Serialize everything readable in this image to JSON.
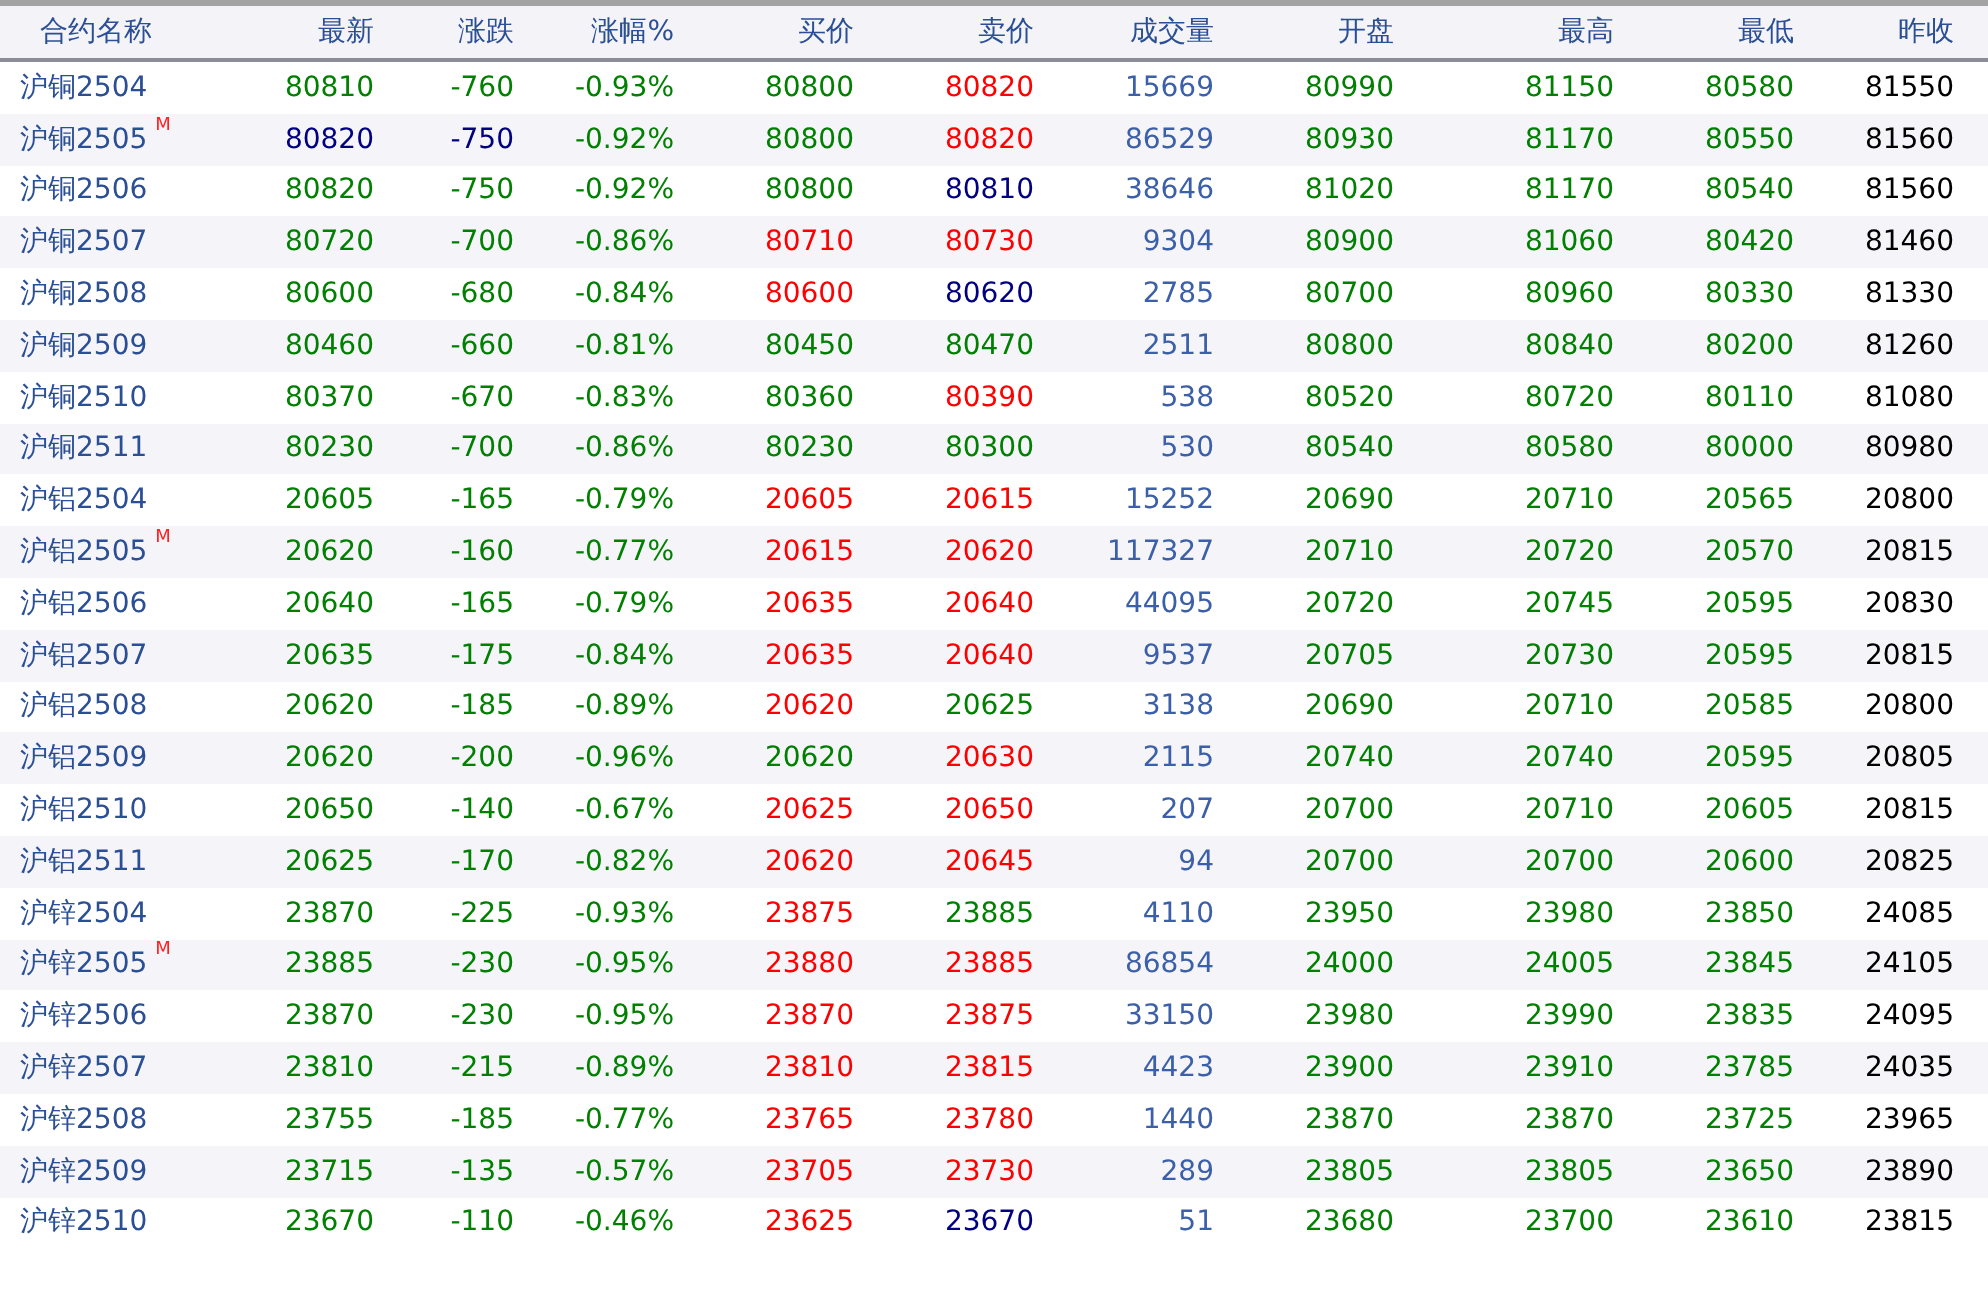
{
  "columns": [
    "合约名称",
    "最新",
    "涨跌",
    "涨幅%",
    "买价",
    "卖价",
    "成交量",
    "开盘",
    "最高",
    "最低",
    "昨收"
  ],
  "rows": [
    {
      "name": "沪铜2504",
      "cells": [
        {
          "text": "80810",
          "color": "#008000"
        },
        {
          "text": "-760",
          "color": "#008000"
        },
        {
          "text": "-0.93%",
          "color": "#008000"
        },
        {
          "text": "80800",
          "color": "#008000"
        },
        {
          "text": "80820",
          "color": "#ff0000"
        },
        {
          "text": "15669",
          "color": "#3b5fa8"
        },
        {
          "text": "80990",
          "color": "#008000"
        },
        {
          "text": "81150",
          "color": "#008000"
        },
        {
          "text": "80580",
          "color": "#008000"
        },
        {
          "text": "81550",
          "color": "#000000"
        }
      ]
    },
    {
      "name": "沪铜2505",
      "tag": "M",
      "cells": [
        {
          "text": "80820",
          "color": "#000080"
        },
        {
          "text": "-750",
          "color": "#000080"
        },
        {
          "text": "-0.92%",
          "color": "#008000"
        },
        {
          "text": "80800",
          "color": "#008000"
        },
        {
          "text": "80820",
          "color": "#ff0000"
        },
        {
          "text": "86529",
          "color": "#3b5fa8"
        },
        {
          "text": "80930",
          "color": "#008000"
        },
        {
          "text": "81170",
          "color": "#008000"
        },
        {
          "text": "80550",
          "color": "#008000"
        },
        {
          "text": "81560",
          "color": "#000000"
        }
      ]
    },
    {
      "name": "沪铜2506",
      "cells": [
        {
          "text": "80820",
          "color": "#008000"
        },
        {
          "text": "-750",
          "color": "#008000"
        },
        {
          "text": "-0.92%",
          "color": "#008000"
        },
        {
          "text": "80800",
          "color": "#008000"
        },
        {
          "text": "80810",
          "color": "#000080"
        },
        {
          "text": "38646",
          "color": "#3b5fa8"
        },
        {
          "text": "81020",
          "color": "#008000"
        },
        {
          "text": "81170",
          "color": "#008000"
        },
        {
          "text": "80540",
          "color": "#008000"
        },
        {
          "text": "81560",
          "color": "#000000"
        }
      ]
    },
    {
      "name": "沪铜2507",
      "cells": [
        {
          "text": "80720",
          "color": "#008000"
        },
        {
          "text": "-700",
          "color": "#008000"
        },
        {
          "text": "-0.86%",
          "color": "#008000"
        },
        {
          "text": "80710",
          "color": "#ff0000"
        },
        {
          "text": "80730",
          "color": "#ff0000"
        },
        {
          "text": "9304",
          "color": "#3b5fa8"
        },
        {
          "text": "80900",
          "color": "#008000"
        },
        {
          "text": "81060",
          "color": "#008000"
        },
        {
          "text": "80420",
          "color": "#008000"
        },
        {
          "text": "81460",
          "color": "#000000"
        }
      ]
    },
    {
      "name": "沪铜2508",
      "cells": [
        {
          "text": "80600",
          "color": "#008000"
        },
        {
          "text": "-680",
          "color": "#008000"
        },
        {
          "text": "-0.84%",
          "color": "#008000"
        },
        {
          "text": "80600",
          "color": "#ff0000"
        },
        {
          "text": "80620",
          "color": "#000080"
        },
        {
          "text": "2785",
          "color": "#3b5fa8"
        },
        {
          "text": "80700",
          "color": "#008000"
        },
        {
          "text": "80960",
          "color": "#008000"
        },
        {
          "text": "80330",
          "color": "#008000"
        },
        {
          "text": "81330",
          "color": "#000000"
        }
      ]
    },
    {
      "name": "沪铜2509",
      "cells": [
        {
          "text": "80460",
          "color": "#008000"
        },
        {
          "text": "-660",
          "color": "#008000"
        },
        {
          "text": "-0.81%",
          "color": "#008000"
        },
        {
          "text": "80450",
          "color": "#008000"
        },
        {
          "text": "80470",
          "color": "#008000"
        },
        {
          "text": "2511",
          "color": "#3b5fa8"
        },
        {
          "text": "80800",
          "color": "#008000"
        },
        {
          "text": "80840",
          "color": "#008000"
        },
        {
          "text": "80200",
          "color": "#008000"
        },
        {
          "text": "81260",
          "color": "#000000"
        }
      ]
    },
    {
      "name": "沪铜2510",
      "cells": [
        {
          "text": "80370",
          "color": "#008000"
        },
        {
          "text": "-670",
          "color": "#008000"
        },
        {
          "text": "-0.83%",
          "color": "#008000"
        },
        {
          "text": "80360",
          "color": "#008000"
        },
        {
          "text": "80390",
          "color": "#ff0000"
        },
        {
          "text": "538",
          "color": "#3b5fa8"
        },
        {
          "text": "80520",
          "color": "#008000"
        },
        {
          "text": "80720",
          "color": "#008000"
        },
        {
          "text": "80110",
          "color": "#008000"
        },
        {
          "text": "81080",
          "color": "#000000"
        }
      ]
    },
    {
      "name": "沪铜2511",
      "cells": [
        {
          "text": "80230",
          "color": "#008000"
        },
        {
          "text": "-700",
          "color": "#008000"
        },
        {
          "text": "-0.86%",
          "color": "#008000"
        },
        {
          "text": "80230",
          "color": "#008000"
        },
        {
          "text": "80300",
          "color": "#008000"
        },
        {
          "text": "530",
          "color": "#3b5fa8"
        },
        {
          "text": "80540",
          "color": "#008000"
        },
        {
          "text": "80580",
          "color": "#008000"
        },
        {
          "text": "80000",
          "color": "#008000"
        },
        {
          "text": "80980",
          "color": "#000000"
        }
      ]
    },
    {
      "name": "沪铝2504",
      "cells": [
        {
          "text": "20605",
          "color": "#008000"
        },
        {
          "text": "-165",
          "color": "#008000"
        },
        {
          "text": "-0.79%",
          "color": "#008000"
        },
        {
          "text": "20605",
          "color": "#ff0000"
        },
        {
          "text": "20615",
          "color": "#ff0000"
        },
        {
          "text": "15252",
          "color": "#3b5fa8"
        },
        {
          "text": "20690",
          "color": "#008000"
        },
        {
          "text": "20710",
          "color": "#008000"
        },
        {
          "text": "20565",
          "color": "#008000"
        },
        {
          "text": "20800",
          "color": "#000000"
        }
      ]
    },
    {
      "name": "沪铝2505",
      "tag": "M",
      "cells": [
        {
          "text": "20620",
          "color": "#008000"
        },
        {
          "text": "-160",
          "color": "#008000"
        },
        {
          "text": "-0.77%",
          "color": "#008000"
        },
        {
          "text": "20615",
          "color": "#ff0000"
        },
        {
          "text": "20620",
          "color": "#ff0000"
        },
        {
          "text": "117327",
          "color": "#3b5fa8"
        },
        {
          "text": "20710",
          "color": "#008000"
        },
        {
          "text": "20720",
          "color": "#008000"
        },
        {
          "text": "20570",
          "color": "#008000"
        },
        {
          "text": "20815",
          "color": "#000000"
        }
      ]
    },
    {
      "name": "沪铝2506",
      "cells": [
        {
          "text": "20640",
          "color": "#008000"
        },
        {
          "text": "-165",
          "color": "#008000"
        },
        {
          "text": "-0.79%",
          "color": "#008000"
        },
        {
          "text": "20635",
          "color": "#ff0000"
        },
        {
          "text": "20640",
          "color": "#ff0000"
        },
        {
          "text": "44095",
          "color": "#3b5fa8"
        },
        {
          "text": "20720",
          "color": "#008000"
        },
        {
          "text": "20745",
          "color": "#008000"
        },
        {
          "text": "20595",
          "color": "#008000"
        },
        {
          "text": "20830",
          "color": "#000000"
        }
      ]
    },
    {
      "name": "沪铝2507",
      "cells": [
        {
          "text": "20635",
          "color": "#008000"
        },
        {
          "text": "-175",
          "color": "#008000"
        },
        {
          "text": "-0.84%",
          "color": "#008000"
        },
        {
          "text": "20635",
          "color": "#ff0000"
        },
        {
          "text": "20640",
          "color": "#ff0000"
        },
        {
          "text": "9537",
          "color": "#3b5fa8"
        },
        {
          "text": "20705",
          "color": "#008000"
        },
        {
          "text": "20730",
          "color": "#008000"
        },
        {
          "text": "20595",
          "color": "#008000"
        },
        {
          "text": "20815",
          "color": "#000000"
        }
      ]
    },
    {
      "name": "沪铝2508",
      "cells": [
        {
          "text": "20620",
          "color": "#008000"
        },
        {
          "text": "-185",
          "color": "#008000"
        },
        {
          "text": "-0.89%",
          "color": "#008000"
        },
        {
          "text": "20620",
          "color": "#ff0000"
        },
        {
          "text": "20625",
          "color": "#008000"
        },
        {
          "text": "3138",
          "color": "#3b5fa8"
        },
        {
          "text": "20690",
          "color": "#008000"
        },
        {
          "text": "20710",
          "color": "#008000"
        },
        {
          "text": "20585",
          "color": "#008000"
        },
        {
          "text": "20800",
          "color": "#000000"
        }
      ]
    },
    {
      "name": "沪铝2509",
      "cells": [
        {
          "text": "20620",
          "color": "#008000"
        },
        {
          "text": "-200",
          "color": "#008000"
        },
        {
          "text": "-0.96%",
          "color": "#008000"
        },
        {
          "text": "20620",
          "color": "#008000"
        },
        {
          "text": "20630",
          "color": "#ff0000"
        },
        {
          "text": "2115",
          "color": "#3b5fa8"
        },
        {
          "text": "20740",
          "color": "#008000"
        },
        {
          "text": "20740",
          "color": "#008000"
        },
        {
          "text": "20595",
          "color": "#008000"
        },
        {
          "text": "20805",
          "color": "#000000"
        }
      ]
    },
    {
      "name": "沪铝2510",
      "cells": [
        {
          "text": "20650",
          "color": "#008000"
        },
        {
          "text": "-140",
          "color": "#008000"
        },
        {
          "text": "-0.67%",
          "color": "#008000"
        },
        {
          "text": "20625",
          "color": "#ff0000"
        },
        {
          "text": "20650",
          "color": "#ff0000"
        },
        {
          "text": "207",
          "color": "#3b5fa8"
        },
        {
          "text": "20700",
          "color": "#008000"
        },
        {
          "text": "20710",
          "color": "#008000"
        },
        {
          "text": "20605",
          "color": "#008000"
        },
        {
          "text": "20815",
          "color": "#000000"
        }
      ]
    },
    {
      "name": "沪铝2511",
      "cells": [
        {
          "text": "20625",
          "color": "#008000"
        },
        {
          "text": "-170",
          "color": "#008000"
        },
        {
          "text": "-0.82%",
          "color": "#008000"
        },
        {
          "text": "20620",
          "color": "#ff0000"
        },
        {
          "text": "20645",
          "color": "#ff0000"
        },
        {
          "text": "94",
          "color": "#3b5fa8"
        },
        {
          "text": "20700",
          "color": "#008000"
        },
        {
          "text": "20700",
          "color": "#008000"
        },
        {
          "text": "20600",
          "color": "#008000"
        },
        {
          "text": "20825",
          "color": "#000000"
        }
      ]
    },
    {
      "name": "沪锌2504",
      "cells": [
        {
          "text": "23870",
          "color": "#008000"
        },
        {
          "text": "-225",
          "color": "#008000"
        },
        {
          "text": "-0.93%",
          "color": "#008000"
        },
        {
          "text": "23875",
          "color": "#ff0000"
        },
        {
          "text": "23885",
          "color": "#008000"
        },
        {
          "text": "4110",
          "color": "#3b5fa8"
        },
        {
          "text": "23950",
          "color": "#008000"
        },
        {
          "text": "23980",
          "color": "#008000"
        },
        {
          "text": "23850",
          "color": "#008000"
        },
        {
          "text": "24085",
          "color": "#000000"
        }
      ]
    },
    {
      "name": "沪锌2505",
      "tag": "M",
      "cells": [
        {
          "text": "23885",
          "color": "#008000"
        },
        {
          "text": "-230",
          "color": "#008000"
        },
        {
          "text": "-0.95%",
          "color": "#008000"
        },
        {
          "text": "23880",
          "color": "#ff0000"
        },
        {
          "text": "23885",
          "color": "#ff0000"
        },
        {
          "text": "86854",
          "color": "#3b5fa8"
        },
        {
          "text": "24000",
          "color": "#008000"
        },
        {
          "text": "24005",
          "color": "#008000"
        },
        {
          "text": "23845",
          "color": "#008000"
        },
        {
          "text": "24105",
          "color": "#000000"
        }
      ]
    },
    {
      "name": "沪锌2506",
      "cells": [
        {
          "text": "23870",
          "color": "#008000"
        },
        {
          "text": "-230",
          "color": "#008000"
        },
        {
          "text": "-0.95%",
          "color": "#008000"
        },
        {
          "text": "23870",
          "color": "#ff0000"
        },
        {
          "text": "23875",
          "color": "#ff0000"
        },
        {
          "text": "33150",
          "color": "#3b5fa8"
        },
        {
          "text": "23980",
          "color": "#008000"
        },
        {
          "text": "23990",
          "color": "#008000"
        },
        {
          "text": "23835",
          "color": "#008000"
        },
        {
          "text": "24095",
          "color": "#000000"
        }
      ]
    },
    {
      "name": "沪锌2507",
      "cells": [
        {
          "text": "23810",
          "color": "#008000"
        },
        {
          "text": "-215",
          "color": "#008000"
        },
        {
          "text": "-0.89%",
          "color": "#008000"
        },
        {
          "text": "23810",
          "color": "#ff0000"
        },
        {
          "text": "23815",
          "color": "#ff0000"
        },
        {
          "text": "4423",
          "color": "#3b5fa8"
        },
        {
          "text": "23900",
          "color": "#008000"
        },
        {
          "text": "23910",
          "color": "#008000"
        },
        {
          "text": "23785",
          "color": "#008000"
        },
        {
          "text": "24035",
          "color": "#000000"
        }
      ]
    },
    {
      "name": "沪锌2508",
      "cells": [
        {
          "text": "23755",
          "color": "#008000"
        },
        {
          "text": "-185",
          "color": "#008000"
        },
        {
          "text": "-0.77%",
          "color": "#008000"
        },
        {
          "text": "23765",
          "color": "#ff0000"
        },
        {
          "text": "23780",
          "color": "#ff0000"
        },
        {
          "text": "1440",
          "color": "#3b5fa8"
        },
        {
          "text": "23870",
          "color": "#008000"
        },
        {
          "text": "23870",
          "color": "#008000"
        },
        {
          "text": "23725",
          "color": "#008000"
        },
        {
          "text": "23965",
          "color": "#000000"
        }
      ]
    },
    {
      "name": "沪锌2509",
      "cells": [
        {
          "text": "23715",
          "color": "#008000"
        },
        {
          "text": "-135",
          "color": "#008000"
        },
        {
          "text": "-0.57%",
          "color": "#008000"
        },
        {
          "text": "23705",
          "color": "#ff0000"
        },
        {
          "text": "23730",
          "color": "#ff0000"
        },
        {
          "text": "289",
          "color": "#3b5fa8"
        },
        {
          "text": "23805",
          "color": "#008000"
        },
        {
          "text": "23805",
          "color": "#008000"
        },
        {
          "text": "23650",
          "color": "#008000"
        },
        {
          "text": "23890",
          "color": "#000000"
        }
      ]
    },
    {
      "name": "沪锌2510",
      "cells": [
        {
          "text": "23670",
          "color": "#008000"
        },
        {
          "text": "-110",
          "color": "#008000"
        },
        {
          "text": "-0.46%",
          "color": "#008000"
        },
        {
          "text": "23625",
          "color": "#ff0000"
        },
        {
          "text": "23670",
          "color": "#000080"
        },
        {
          "text": "51",
          "color": "#3b5fa8"
        },
        {
          "text": "23680",
          "color": "#008000"
        },
        {
          "text": "23700",
          "color": "#008000"
        },
        {
          "text": "23610",
          "color": "#008000"
        },
        {
          "text": "23815",
          "color": "#000000"
        }
      ]
    }
  ]
}
